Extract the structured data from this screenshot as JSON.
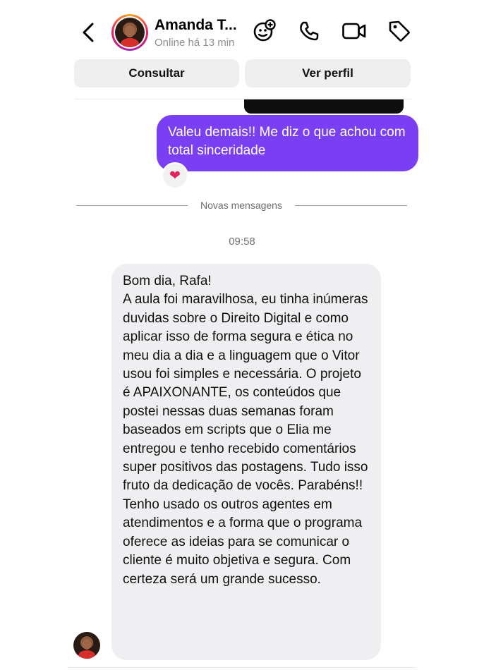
{
  "header": {
    "back_icon": "chevron-left-icon",
    "contact_name": "Amanda T...",
    "status": "Online há 13 min",
    "icons": [
      "sticker-add-icon",
      "phone-icon",
      "video-camera-icon",
      "tag-icon"
    ]
  },
  "actions": {
    "consult_label": "Consultar",
    "profile_label": "Ver perfil"
  },
  "thread": {
    "outgoing_message": "Valeu demais!! Me diz o que achou com total sinceridade",
    "reaction": "❤",
    "separator_label": "Novas mensagens",
    "timestamp": "09:58",
    "incoming_message_lines": [
      "Bom dia, Rafa!",
      "A aula foi maravilhosa, eu tinha inúmeras duvidas sobre o Direito Digital e como aplicar isso de forma segura e ética no meu dia a dia e a linguagem que o Vitor usou foi simples e necessária. O projeto é APAIXONANTE, os conteúdos que postei nessas duas semanas foram baseados em scripts que o Elia me entregou e tenho recebido comentários super positivos das postagens. Tudo isso fruto da dedicação de vocês. Parabéns!!",
      "Tenho usado os outros agentes em atendimentos e a forma que o programa oferece as ideias para se comunicar o cliente é muito objetiva e segura. Com certeza será um grande sucesso."
    ]
  },
  "colors": {
    "outgoing_bubble": "#7a3ff2",
    "incoming_bubble": "#efeff1",
    "action_button": "#efefef",
    "heart": "#e0245e"
  }
}
